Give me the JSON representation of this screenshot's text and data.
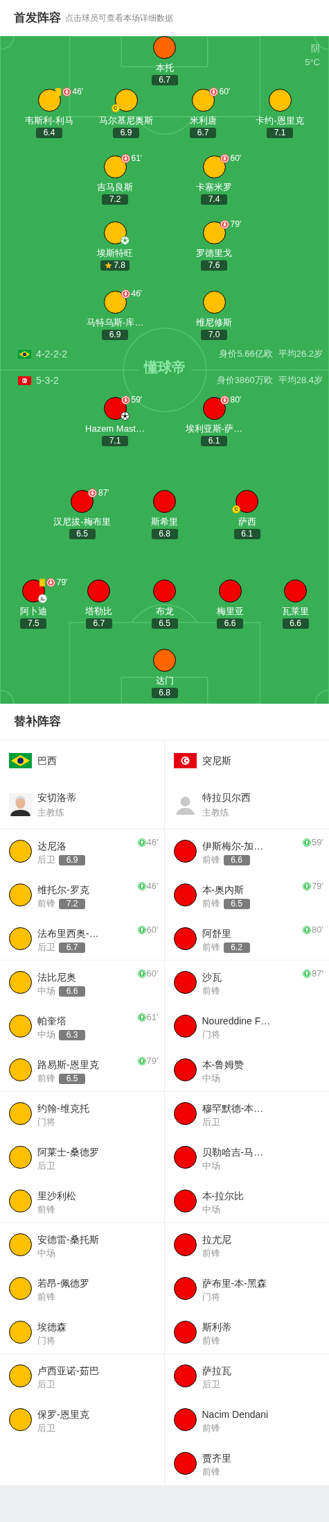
{
  "header": {
    "title": "首发阵容",
    "subtitle": "点击球员可查看本场详细数据"
  },
  "pitch": {
    "weather": "阴",
    "temperature": "5°C",
    "logo": "懂球帝",
    "teams": [
      {
        "kind": "brazil",
        "formation": "4-2-2-2",
        "market_value": "身价5.66亿欧",
        "average_age": "平均26.2岁",
        "lines": [
          {
            "players": [
              {
                "name": "本托",
                "rating": "6.7",
                "color": "#ff6600"
              }
            ]
          },
          {
            "players": [
              {
                "name": "韦斯利-利马",
                "rating": "6.4",
                "color": "#ffc000",
                "events": [
                  {
                    "kind": "yellow_card"
                  },
                  {
                    "kind": "sub_off",
                    "minute": "46'"
                  }
                ]
              },
              {
                "name": "马尔基尼奥斯",
                "rating": "6.9",
                "color": "#ffc000",
                "events": [
                  {
                    "kind": "captain",
                    "label": "C"
                  }
                ]
              },
              {
                "name": "米利唐",
                "rating": "6.7",
                "color": "#ffc000",
                "events": [
                  {
                    "kind": "sub_off",
                    "minute": "60'"
                  }
                ]
              },
              {
                "name": "卡约-恩里克",
                "rating": "7.1",
                "color": "#ffc000"
              }
            ]
          },
          {
            "players": [
              {
                "name": "吉马良斯",
                "rating": "7.2",
                "color": "#ffc000",
                "events": [
                  {
                    "kind": "sub_off",
                    "minute": "61'"
                  }
                ]
              },
              {
                "name": "卡塞米罗",
                "rating": "7.4",
                "color": "#ffc000",
                "events": [
                  {
                    "kind": "sub_off",
                    "minute": "60'"
                  }
                ]
              }
            ]
          },
          {
            "players": [
              {
                "name": "埃斯特旺",
                "rating": "7.8",
                "color": "#ffc000",
                "events": [
                  {
                    "kind": "goal_green"
                  },
                  {
                    "kind": "mvp"
                  }
                ]
              },
              {
                "name": "罗德里戈",
                "rating": "7.6",
                "color": "#ffc000",
                "events": [
                  {
                    "kind": "sub_off",
                    "minute": "79'"
                  }
                ]
              }
            ]
          },
          {
            "players": [
              {
                "name": "马特乌斯-库…",
                "rating": "6.9",
                "color": "#ffc000",
                "events": [
                  {
                    "kind": "sub_off",
                    "minute": "46'"
                  }
                ]
              },
              {
                "name": "维尼修斯",
                "rating": "7.0",
                "color": "#ffc000"
              }
            ]
          }
        ]
      },
      {
        "kind": "tunisia",
        "formation": "5-3-2",
        "market_value": "身价3860万欧",
        "average_age": "平均28.4岁",
        "lines": [
          {
            "players": [
              {
                "name": "Hazem Mast…",
                "rating": "7.1",
                "color": "#f20000",
                "events": [
                  {
                    "kind": "sub_off",
                    "minute": "59'"
                  },
                  {
                    "kind": "goal"
                  }
                ]
              },
              {
                "name": "埃利亚斯-萨…",
                "rating": "6.1",
                "color": "#f20000",
                "events": [
                  {
                    "kind": "sub_off",
                    "minute": "80'"
                  }
                ]
              }
            ]
          },
          {
            "players": [
              {
                "name": "汉尼拔-梅布里",
                "rating": "6.5",
                "color": "#f20000",
                "events": [
                  {
                    "kind": "sub_off",
                    "minute": "87'"
                  }
                ]
              },
              {
                "name": "斯希里",
                "rating": "6.8",
                "color": "#f20000"
              },
              {
                "name": "萨西",
                "rating": "6.1",
                "color": "#f20000",
                "events": [
                  {
                    "kind": "captain",
                    "label": "C"
                  }
                ]
              }
            ]
          },
          {
            "players": [
              {
                "name": "阿卜迪",
                "rating": "7.5",
                "color": "#f20000",
                "events": [
                  {
                    "kind": "yellow_card"
                  },
                  {
                    "kind": "sub_off",
                    "minute": "79'"
                  },
                  {
                    "kind": "assist"
                  }
                ]
              },
              {
                "name": "塔勒比",
                "rating": "6.7",
                "color": "#f20000"
              },
              {
                "name": "布龙",
                "rating": "6.5",
                "color": "#f20000"
              },
              {
                "name": "梅里亚",
                "rating": "6.6",
                "color": "#f20000"
              },
              {
                "name": "瓦莱里",
                "rating": "6.6",
                "color": "#f20000"
              }
            ]
          },
          {
            "players": [
              {
                "name": "达门",
                "rating": "6.8",
                "color": "#ff6600"
              }
            ]
          }
        ]
      }
    ]
  },
  "substitutes": {
    "title": "替补阵容",
    "teams": [
      {
        "kind": "brazil",
        "name": "巴西",
        "coach": {
          "name": "安切洛蒂",
          "role": "主教练",
          "kind": "photo"
        },
        "players": [
          {
            "name": "达尼洛",
            "position": "后卫",
            "rating": "6.9",
            "sub_on": "46'",
            "color": "#ffc000"
          },
          {
            "name": "维托尔-罗克",
            "position": "前锋",
            "rating": "7.2",
            "sub_on": "46'",
            "color": "#ffc000"
          },
          {
            "name": "法布里西奥-…",
            "position": "后卫",
            "rating": "6.7",
            "sub_on": "60'",
            "color": "#ffc000"
          },
          {
            "name": "法比尼奥",
            "position": "中场",
            "rating": "6.6",
            "sub_on": "60'",
            "color": "#ffc000"
          },
          {
            "name": "帕奎塔",
            "position": "中场",
            "rating": "6.3",
            "sub_on": "61'",
            "color": "#ffc000"
          },
          {
            "name": "路易斯-恩里克",
            "position": "前锋",
            "rating": "6.5",
            "sub_on": "79'",
            "color": "#ffc000"
          },
          {
            "name": "约翰-维克托",
            "position": "门将",
            "color": "#ffc000"
          },
          {
            "name": "阿莱士-桑德罗",
            "position": "后卫",
            "color": "#ffc000"
          },
          {
            "name": "里沙利松",
            "position": "前锋",
            "color": "#ffc000"
          },
          {
            "name": "安德雷-桑托斯",
            "position": "中场",
            "color": "#ffc000"
          },
          {
            "name": "若昂-佩德罗",
            "position": "前锋",
            "color": "#ffc000"
          },
          {
            "name": "埃德森",
            "position": "门将",
            "color": "#ffc000"
          },
          {
            "name": "卢西亚诺-茹巴",
            "position": "后卫",
            "color": "#ffc000"
          },
          {
            "name": "保罗-恩里克",
            "position": "后卫",
            "color": "#ffc000"
          }
        ]
      },
      {
        "kind": "tunisia",
        "name": "突尼斯",
        "coach": {
          "name": "特拉贝尔西",
          "role": "主教练",
          "kind": "placeholder"
        },
        "players": [
          {
            "name": "伊斯梅尔-加…",
            "position": "前锋",
            "rating": "6.6",
            "sub_on": "59'",
            "color": "#f20000"
          },
          {
            "name": "本-奥内斯",
            "position": "前锋",
            "rating": "6.5",
            "sub_on": "79'",
            "color": "#f20000"
          },
          {
            "name": "阿舒里",
            "position": "前锋",
            "rating": "6.2",
            "sub_on": "80'",
            "color": "#f20000"
          },
          {
            "name": "沙瓦",
            "position": "前锋",
            "sub_on": "87'",
            "color": "#f20000"
          },
          {
            "name": "Noureddine F…",
            "position": "门将",
            "color": "#f20000"
          },
          {
            "name": "本-鲁姆赞",
            "position": "中场",
            "color": "#f20000"
          },
          {
            "name": "穆罕默德-本…",
            "position": "后卫",
            "color": "#f20000"
          },
          {
            "name": "贝勒哈吉-马…",
            "position": "中场",
            "color": "#f20000"
          },
          {
            "name": "本-拉尔比",
            "position": "中场",
            "color": "#f20000"
          },
          {
            "name": "拉尤尼",
            "position": "前锋",
            "color": "#f20000"
          },
          {
            "name": "萨布里-本-黑森",
            "position": "门将",
            "color": "#f20000"
          },
          {
            "name": "斯利蒂",
            "position": "前锋",
            "color": "#f20000"
          },
          {
            "name": "萨拉瓦",
            "position": "后卫",
            "color": "#f20000"
          },
          {
            "name": "Nacim Dendani",
            "position": "前锋",
            "color": "#f20000"
          },
          {
            "name": "贾齐里",
            "position": "前锋",
            "color": "#f20000"
          }
        ]
      }
    ]
  }
}
